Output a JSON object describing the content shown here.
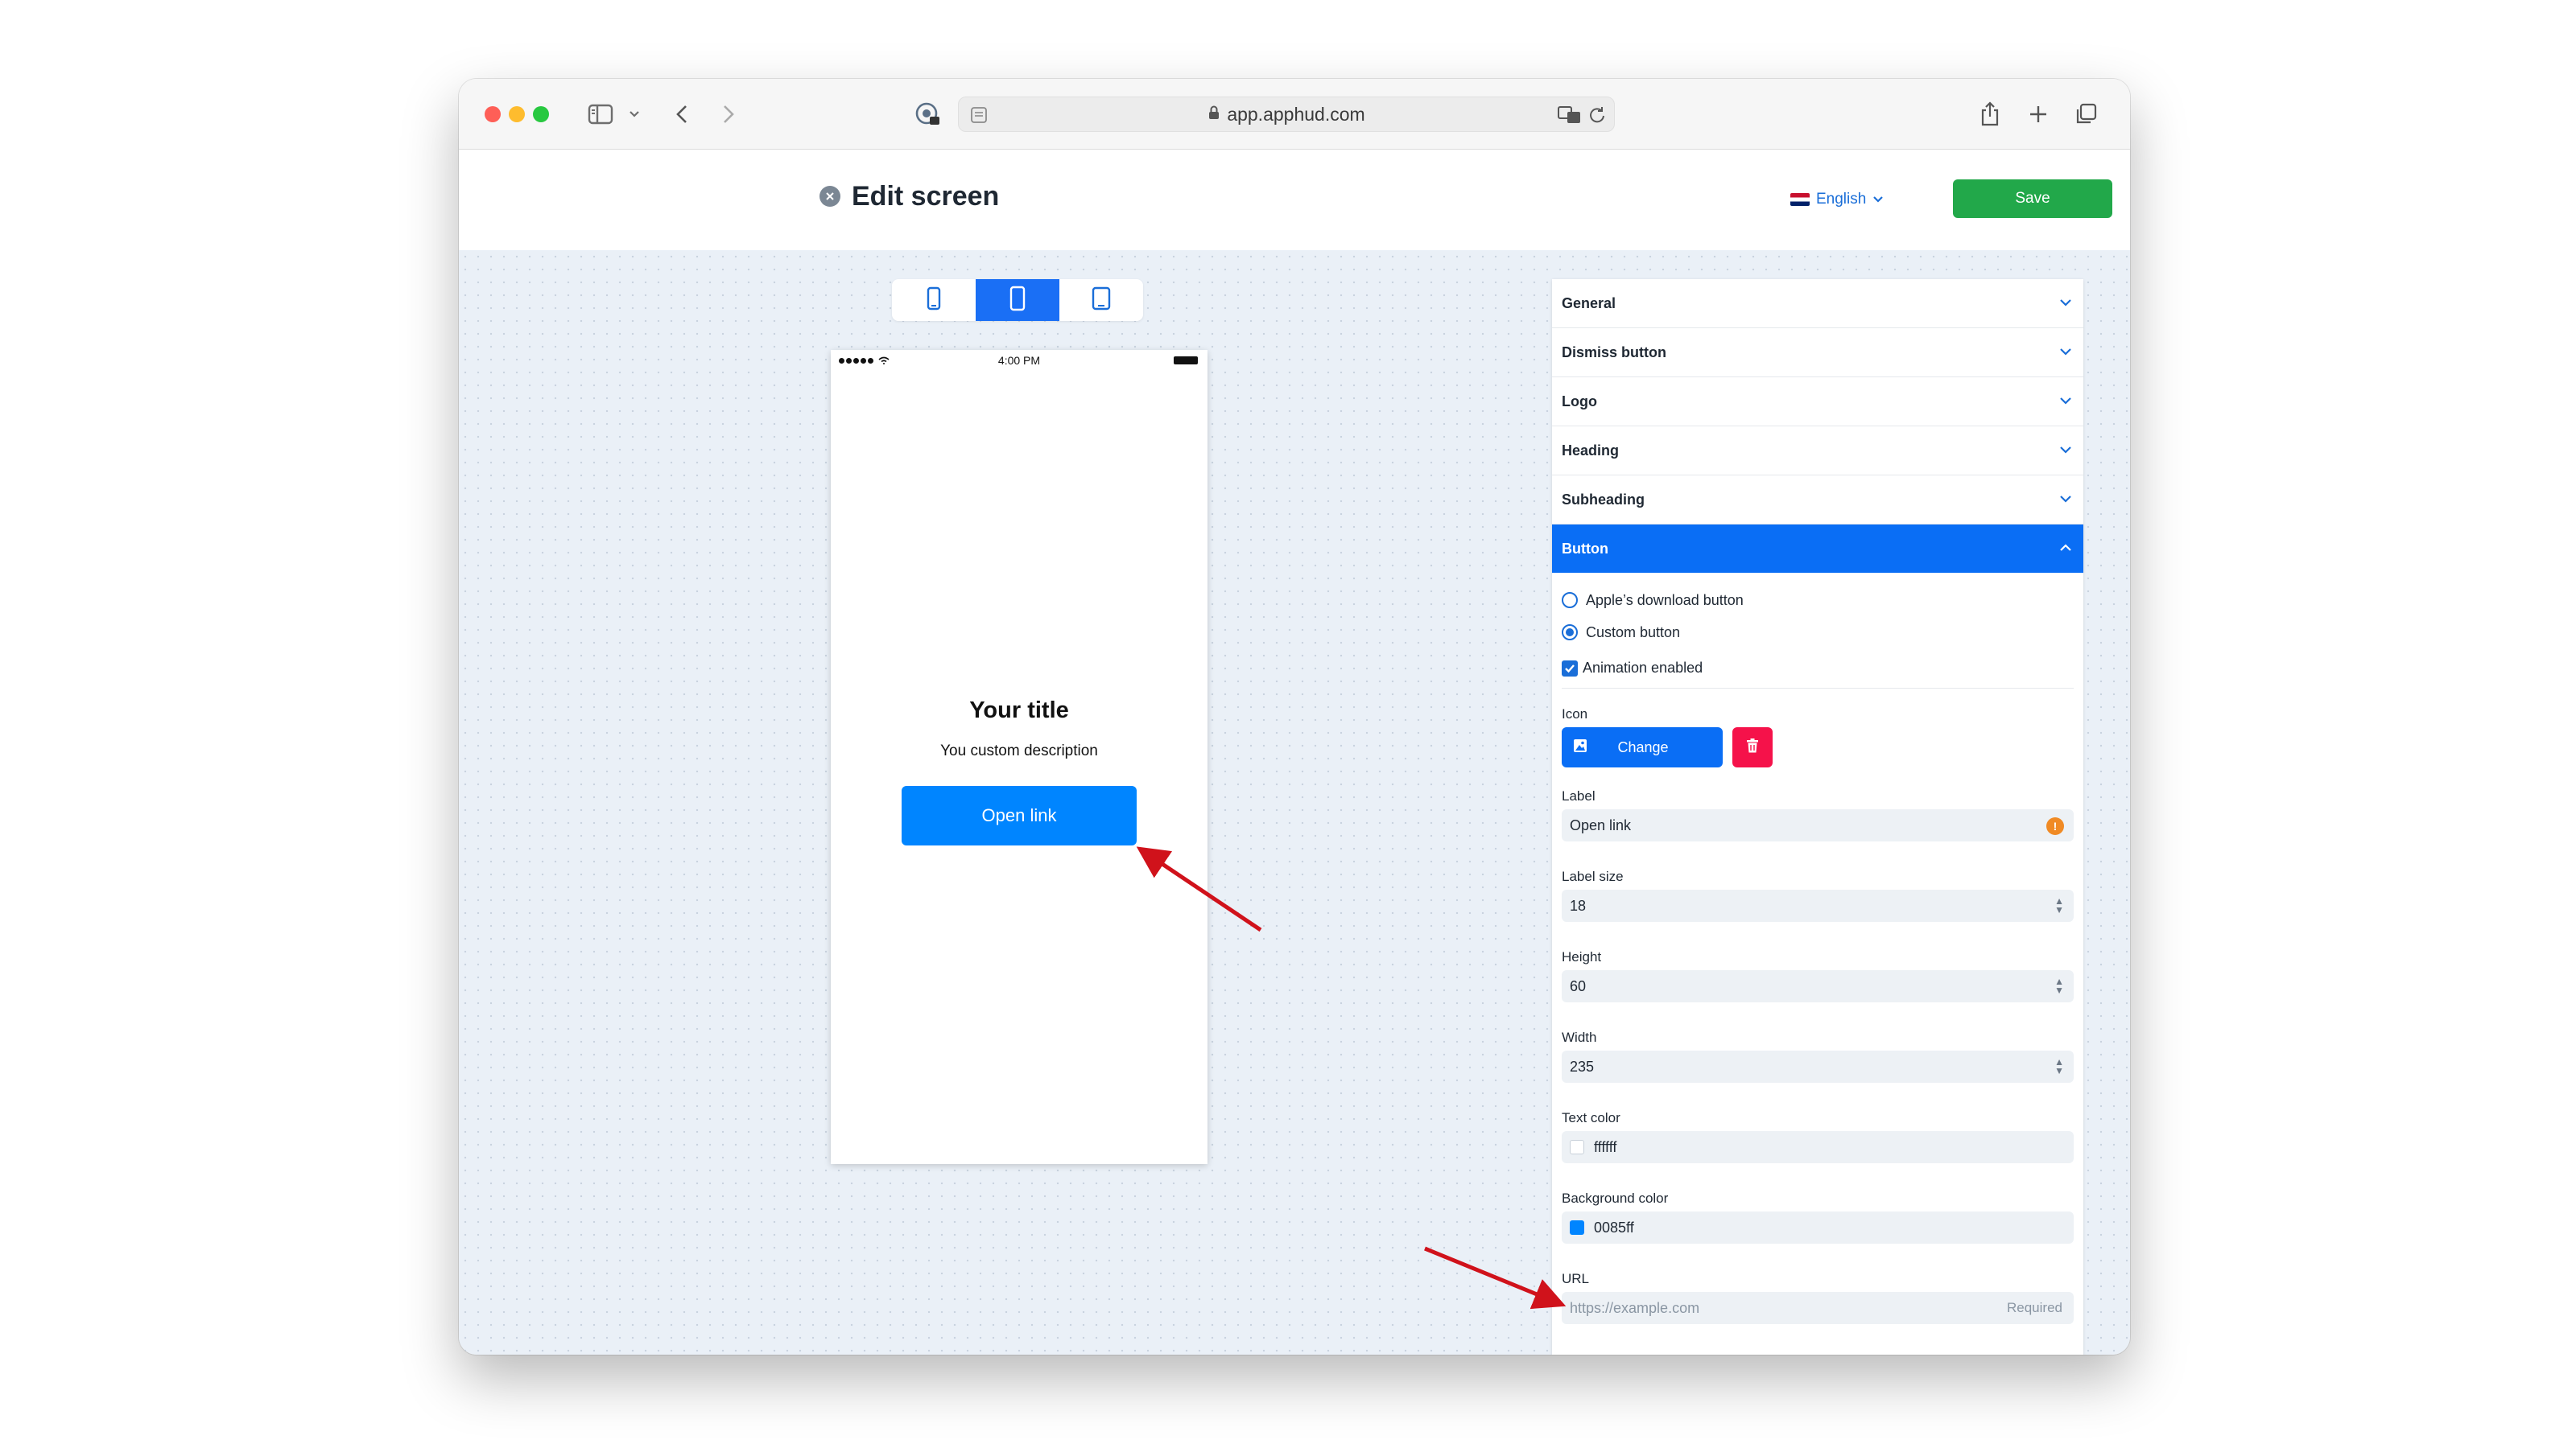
{
  "browser": {
    "url": "app.apphud.com"
  },
  "header": {
    "title": "Edit screen",
    "language": "English",
    "save_label": "Save"
  },
  "preview": {
    "status_time": "4:00 PM",
    "title": "Your title",
    "description": "You custom description",
    "button_label": "Open link",
    "button_color": "#0085ff"
  },
  "panel": {
    "sections": [
      "General",
      "Dismiss button",
      "Logo",
      "Heading",
      "Subheading"
    ],
    "open_section": "Button",
    "button_options": {
      "apple_download": "Apple’s download button",
      "custom": "Custom button",
      "selected": "Custom button",
      "animation_label": "Animation enabled",
      "animation_checked": true
    },
    "icon": {
      "label": "Icon",
      "change_label": "Change"
    },
    "fields": {
      "label": {
        "label": "Label",
        "value": "Open link"
      },
      "label_size": {
        "label": "Label size",
        "value": "18"
      },
      "height": {
        "label": "Height",
        "value": "60"
      },
      "width": {
        "label": "Width",
        "value": "235"
      },
      "text_color": {
        "label": "Text color",
        "value": "ffffff",
        "swatch": "#ffffff"
      },
      "background_color": {
        "label": "Background color",
        "value": "0085ff",
        "swatch": "#0085ff"
      },
      "url": {
        "label": "URL",
        "placeholder": "https://example.com",
        "required": "Required"
      }
    }
  },
  "colors": {
    "accent": "#0a6ef5",
    "save": "#22a84a",
    "delete": "#f5124a",
    "annotation_arrow": "#d0121b"
  }
}
